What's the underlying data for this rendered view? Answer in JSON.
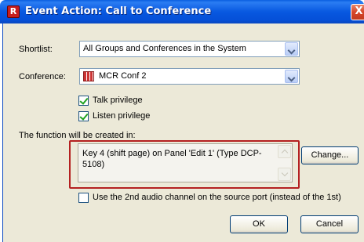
{
  "window": {
    "title": "Event Action: Call to Conference",
    "app_icon_glyph": "R",
    "close_glyph": "X"
  },
  "form": {
    "shortlist_label": "Shortlist:",
    "shortlist_value": "All Groups and Conferences in the System",
    "conference_label": "Conference:",
    "conference_value": "MCR Conf 2",
    "talk_privilege_label": "Talk privilege",
    "talk_privilege_checked": true,
    "listen_privilege_label": "Listen privilege",
    "listen_privilege_checked": true,
    "function_location_label": "The function will be created in:",
    "function_location_value": "Key 4 (shift page) on Panel 'Edit 1' (Type DCP-5108)",
    "change_button": "Change...",
    "second_audio_label": "Use the 2nd audio channel on the source port (instead of the 1st)",
    "second_audio_checked": false
  },
  "buttons": {
    "ok": "OK",
    "cancel": "Cancel"
  },
  "icons": {
    "app": "app-logo-icon",
    "close": "close-icon",
    "conference": "conference-icon",
    "dropdown": "chevron-down-icon"
  },
  "colors": {
    "titlebar": "#0858e0",
    "dialog_bg": "#ece9d8",
    "highlight_box": "#b42020"
  }
}
